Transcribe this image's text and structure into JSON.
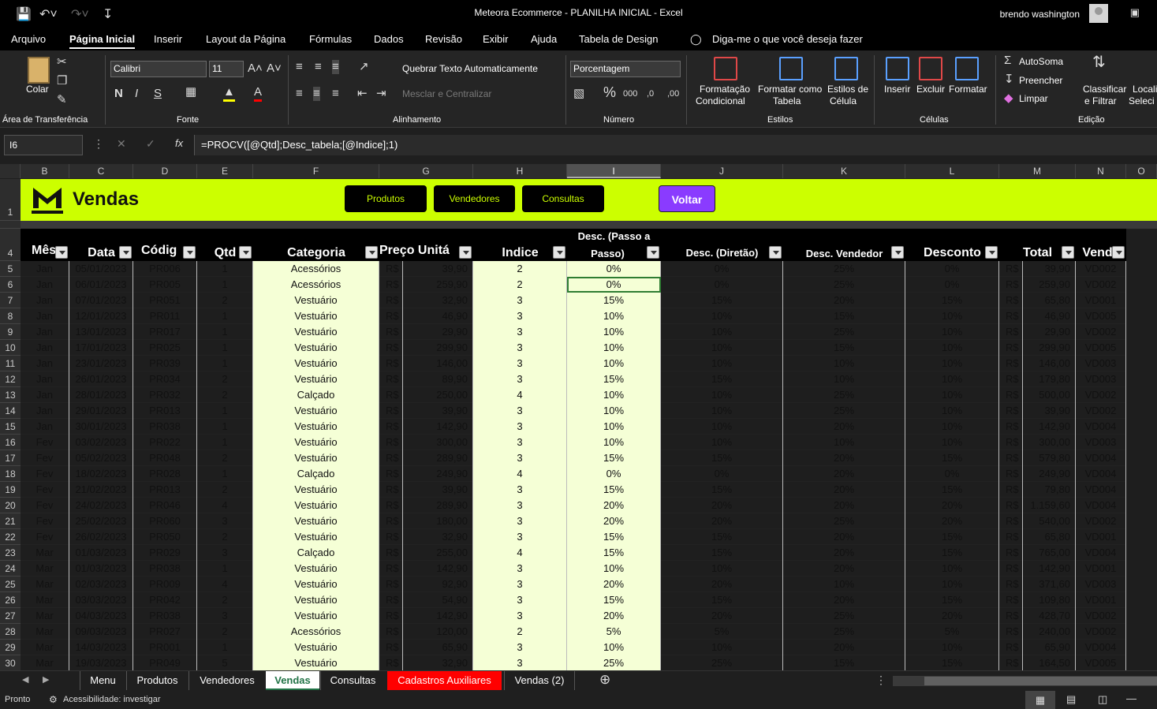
{
  "window": {
    "title": "Meteora Ecommerce - PLANILHA INICIAL  -  Excel",
    "user": "brendo washington"
  },
  "menu": {
    "tabs": [
      "Arquivo",
      "Página Inicial",
      "Inserir",
      "Layout da Página",
      "Fórmulas",
      "Dados",
      "Revisão",
      "Exibir",
      "Ajuda",
      "Tabela de Design"
    ],
    "tell_me": "Diga-me o que você deseja fazer"
  },
  "ribbon": {
    "groups": [
      "Área de Transferência",
      "Fonte",
      "Alinhamento",
      "Número",
      "Estilos",
      "Células",
      "Edição"
    ],
    "paste": "Colar",
    "font_name": "Calibri",
    "font_size": "11",
    "wrap_text": "Quebrar Texto Automaticamente",
    "merge_center": "Mesclar e Centralizar",
    "number_format": "Porcentagem",
    "cond_format_1": "Formatação",
    "cond_format_2": "Condicional",
    "format_table_1": "Formatar como",
    "format_table_2": "Tabela",
    "cell_styles_1": "Estilos de",
    "cell_styles_2": "Célula",
    "insert": "Inserir",
    "delete": "Excluir",
    "format": "Formatar",
    "autosum": "AutoSoma",
    "fill": "Preencher",
    "clear": "Limpar",
    "sort_1": "Classificar",
    "sort_2": "e Filtrar",
    "find_1": "Locali",
    "find_2": "Seleci"
  },
  "formula_bar": {
    "name_box": "I6",
    "formula": "=PROCV([@Qtd];Desc_tabela;[@Indice];1)"
  },
  "columns": [
    "B",
    "C",
    "D",
    "E",
    "F",
    "G",
    "H",
    "I",
    "J",
    "K",
    "L",
    "M",
    "N",
    "O"
  ],
  "banner": {
    "title": "Vendas",
    "buttons": [
      "Produtos",
      "Vendedores",
      "Consultas"
    ],
    "back": "Voltar"
  },
  "headers": {
    "mes": "Mês",
    "data": "Data",
    "codigo": "Códig",
    "qtd": "Qtd",
    "categoria": "Categoria",
    "preco": "Preço Unitá",
    "indice": "Indice",
    "desc_passo_1": "Desc. (Passo a",
    "desc_passo_2": "Passo)",
    "desc_diretao": "Desc. (Diretão)",
    "desc_vendedor": "Desc. Vendedor",
    "desconto": "Desconto",
    "total": "Total",
    "vendedor": "Vende"
  },
  "rows": [
    [
      "5",
      "Jan",
      "05/01/2023",
      "PR006",
      "1",
      "Acessórios",
      "R$",
      "39,90",
      "2",
      "0%",
      "0%",
      "25%",
      "0%",
      "R$",
      "39,90",
      "VD002"
    ],
    [
      "6",
      "Jan",
      "06/01/2023",
      "PR005",
      "1",
      "Acessórios",
      "R$",
      "259,90",
      "2",
      "0%",
      "0%",
      "25%",
      "0%",
      "R$",
      "259,90",
      "VD002"
    ],
    [
      "7",
      "Jan",
      "07/01/2023",
      "PR051",
      "2",
      "Vestuário",
      "R$",
      "32,90",
      "3",
      "15%",
      "15%",
      "20%",
      "15%",
      "R$",
      "65,80",
      "VD001"
    ],
    [
      "8",
      "Jan",
      "12/01/2023",
      "PR011",
      "1",
      "Vestuário",
      "R$",
      "46,90",
      "3",
      "10%",
      "10%",
      "15%",
      "10%",
      "R$",
      "46,90",
      "VD005"
    ],
    [
      "9",
      "Jan",
      "13/01/2023",
      "PR017",
      "1",
      "Vestuário",
      "R$",
      "29,90",
      "3",
      "10%",
      "10%",
      "25%",
      "10%",
      "R$",
      "29,90",
      "VD002"
    ],
    [
      "10",
      "Jan",
      "17/01/2023",
      "PR025",
      "1",
      "Vestuário",
      "R$",
      "299,90",
      "3",
      "10%",
      "10%",
      "15%",
      "10%",
      "R$",
      "299,90",
      "VD005"
    ],
    [
      "11",
      "Jan",
      "23/01/2023",
      "PR039",
      "1",
      "Vestuário",
      "R$",
      "146,00",
      "3",
      "10%",
      "10%",
      "10%",
      "10%",
      "R$",
      "146,00",
      "VD003"
    ],
    [
      "12",
      "Jan",
      "26/01/2023",
      "PR034",
      "2",
      "Vestuário",
      "R$",
      "89,90",
      "3",
      "15%",
      "15%",
      "10%",
      "10%",
      "R$",
      "179,80",
      "VD003"
    ],
    [
      "13",
      "Jan",
      "28/01/2023",
      "PR032",
      "2",
      "Calçado",
      "R$",
      "250,00",
      "4",
      "10%",
      "10%",
      "25%",
      "10%",
      "R$",
      "500,00",
      "VD002"
    ],
    [
      "14",
      "Jan",
      "29/01/2023",
      "PR013",
      "1",
      "Vestuário",
      "R$",
      "39,90",
      "3",
      "10%",
      "10%",
      "25%",
      "10%",
      "R$",
      "39,90",
      "VD002"
    ],
    [
      "15",
      "Jan",
      "30/01/2023",
      "PR038",
      "1",
      "Vestuário",
      "R$",
      "142,90",
      "3",
      "10%",
      "10%",
      "20%",
      "10%",
      "R$",
      "142,90",
      "VD004"
    ],
    [
      "16",
      "Fev",
      "03/02/2023",
      "PR022",
      "1",
      "Vestuário",
      "R$",
      "300,00",
      "3",
      "10%",
      "10%",
      "10%",
      "10%",
      "R$",
      "300,00",
      "VD003"
    ],
    [
      "17",
      "Fev",
      "05/02/2023",
      "PR048",
      "2",
      "Vestuário",
      "R$",
      "289,90",
      "3",
      "15%",
      "15%",
      "20%",
      "15%",
      "R$",
      "579,80",
      "VD004"
    ],
    [
      "18",
      "Fev",
      "18/02/2023",
      "PR028",
      "1",
      "Calçado",
      "R$",
      "249,90",
      "4",
      "0%",
      "0%",
      "20%",
      "0%",
      "R$",
      "249,90",
      "VD004"
    ],
    [
      "19",
      "Fev",
      "21/02/2023",
      "PR013",
      "2",
      "Vestuário",
      "R$",
      "39,90",
      "3",
      "15%",
      "15%",
      "20%",
      "15%",
      "R$",
      "79,80",
      "VD004"
    ],
    [
      "20",
      "Fev",
      "24/02/2023",
      "PR046",
      "4",
      "Vestuário",
      "R$",
      "289,90",
      "3",
      "20%",
      "20%",
      "20%",
      "20%",
      "R$",
      "1.159,60",
      "VD004"
    ],
    [
      "21",
      "Fev",
      "25/02/2023",
      "PR060",
      "3",
      "Vestuário",
      "R$",
      "180,00",
      "3",
      "20%",
      "20%",
      "25%",
      "20%",
      "R$",
      "540,00",
      "VD002"
    ],
    [
      "22",
      "Fev",
      "26/02/2023",
      "PR050",
      "2",
      "Vestuário",
      "R$",
      "32,90",
      "3",
      "15%",
      "15%",
      "20%",
      "15%",
      "R$",
      "65,80",
      "VD001"
    ],
    [
      "23",
      "Mar",
      "01/03/2023",
      "PR029",
      "3",
      "Calçado",
      "R$",
      "255,00",
      "4",
      "15%",
      "15%",
      "20%",
      "15%",
      "R$",
      "765,00",
      "VD004"
    ],
    [
      "24",
      "Mar",
      "01/03/2023",
      "PR038",
      "1",
      "Vestuário",
      "R$",
      "142,90",
      "3",
      "10%",
      "10%",
      "20%",
      "10%",
      "R$",
      "142,90",
      "VD001"
    ],
    [
      "25",
      "Mar",
      "02/03/2023",
      "PR009",
      "4",
      "Vestuário",
      "R$",
      "92,90",
      "3",
      "20%",
      "20%",
      "10%",
      "10%",
      "R$",
      "371,60",
      "VD003"
    ],
    [
      "26",
      "Mar",
      "03/03/2023",
      "PR042",
      "2",
      "Vestuário",
      "R$",
      "54,90",
      "3",
      "15%",
      "15%",
      "20%",
      "15%",
      "R$",
      "109,80",
      "VD001"
    ],
    [
      "27",
      "Mar",
      "04/03/2023",
      "PR038",
      "3",
      "Vestuário",
      "R$",
      "142,90",
      "3",
      "20%",
      "20%",
      "25%",
      "20%",
      "R$",
      "428,70",
      "VD002"
    ],
    [
      "28",
      "Mar",
      "09/03/2023",
      "PR027",
      "2",
      "Acessórios",
      "R$",
      "120,00",
      "2",
      "5%",
      "5%",
      "25%",
      "5%",
      "R$",
      "240,00",
      "VD002"
    ],
    [
      "29",
      "Mar",
      "14/03/2023",
      "PR001",
      "1",
      "Vestuário",
      "R$",
      "65,90",
      "3",
      "10%",
      "10%",
      "20%",
      "10%",
      "R$",
      "65,90",
      "VD004"
    ],
    [
      "30",
      "Mar",
      "19/03/2023",
      "PR049",
      "5",
      "Vestuário",
      "R$",
      "32,90",
      "3",
      "25%",
      "25%",
      "15%",
      "15%",
      "R$",
      "164,50",
      "VD005"
    ]
  ],
  "sheets": [
    "Menu",
    "Produtos",
    "Vendedores",
    "Vendas",
    "Consultas",
    "Cadastros Auxiliares",
    "Vendas (2)"
  ],
  "active_sheet": "Vendas",
  "status": {
    "ready": "Pronto",
    "accessibility": "Acessibilidade: investigar"
  },
  "colors": {
    "banner": "#ccff00",
    "accent_button": "#8a3bff",
    "highlight": "#f5ffd6",
    "excel_green": "#217346"
  }
}
